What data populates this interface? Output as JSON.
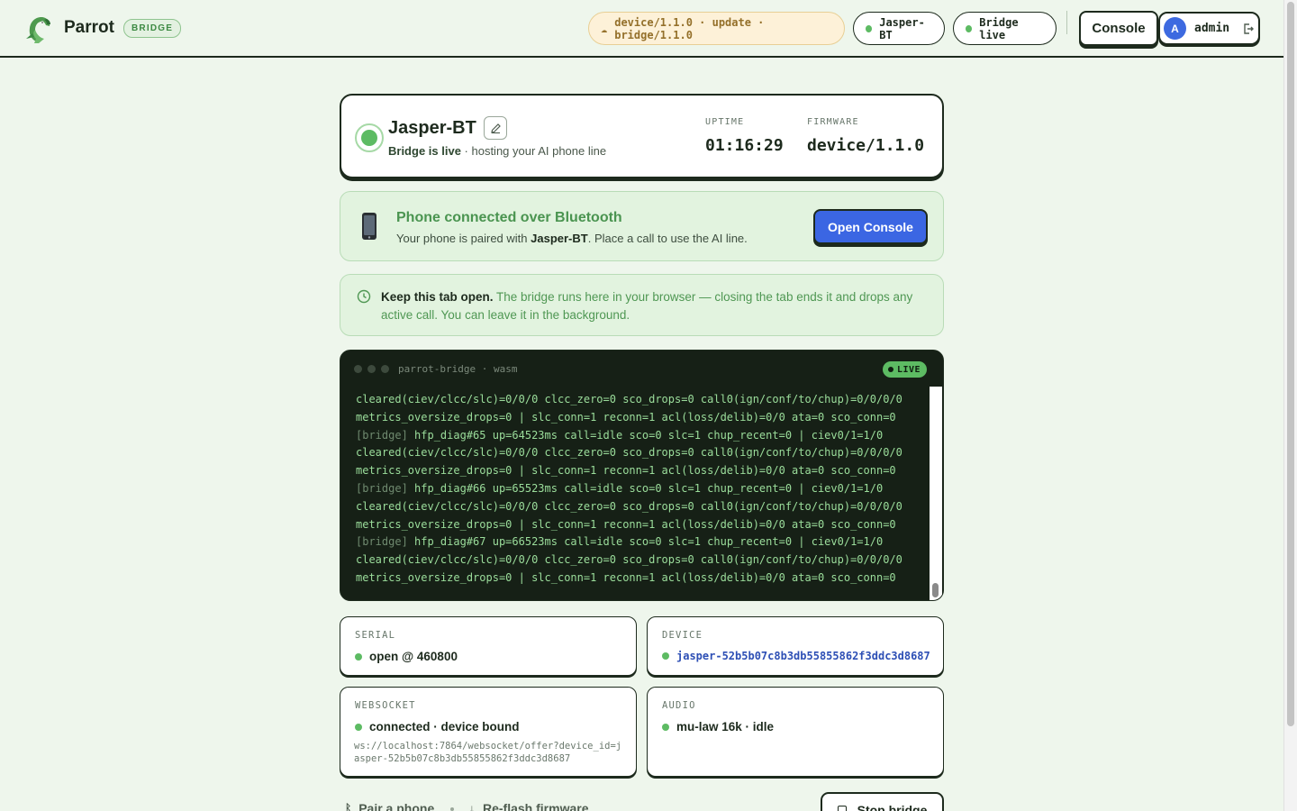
{
  "header": {
    "brand": "Parrot",
    "brand_badge": "BRIDGE",
    "update_pill": "device/1.1.0 · update · bridge/1.1.0",
    "device_pill": "Jasper-BT",
    "live_pill": "Bridge live",
    "console_button": "Console",
    "user": {
      "avatar_letter": "A",
      "name": "admin"
    }
  },
  "status": {
    "device_name": "Jasper-BT",
    "status_bold": "Bridge is live",
    "status_rest": "· hosting your AI phone line",
    "uptime_label": "UPTIME",
    "uptime_value": "01:16:29",
    "firmware_label": "FIRMWARE",
    "firmware_value": "device/1.1.0"
  },
  "bluetooth": {
    "title": "Phone connected over Bluetooth",
    "sub_prefix": "Your phone is paired with",
    "sub_device": "Jasper-BT",
    "sub_suffix": ". Place a call to use the AI line.",
    "open_console": "Open Console"
  },
  "keep_open": {
    "bold": "Keep this tab open.",
    "rest": "The bridge runs here in your browser — closing the tab ends it and drops any active call. You can leave it in the background."
  },
  "terminal": {
    "title": "parrot-bridge · wasm",
    "live_badge": "LIVE",
    "lines": [
      {
        "tag": "",
        "text": "cleared(ciev/clcc/slc)=0/0/0 clcc_zero=0 sco_drops=0 call0(ign/conf/to/chup)=0/0/0/0"
      },
      {
        "tag": "",
        "text": "metrics_oversize_drops=0 | slc_conn=1 reconn=1 acl(loss/delib)=0/0 ata=0 sco_conn=0"
      },
      {
        "tag": "[bridge]",
        "text": "hfp_diag#65 up=64523ms call=idle sco=0 slc=1 chup_recent=0 | ciev0/1=1/0"
      },
      {
        "tag": "",
        "text": "cleared(ciev/clcc/slc)=0/0/0 clcc_zero=0 sco_drops=0 call0(ign/conf/to/chup)=0/0/0/0"
      },
      {
        "tag": "",
        "text": "metrics_oversize_drops=0 | slc_conn=1 reconn=1 acl(loss/delib)=0/0 ata=0 sco_conn=0"
      },
      {
        "tag": "[bridge]",
        "text": "hfp_diag#66 up=65523ms call=idle sco=0 slc=1 chup_recent=0 | ciev0/1=1/0"
      },
      {
        "tag": "",
        "text": "cleared(ciev/clcc/slc)=0/0/0 clcc_zero=0 sco_drops=0 call0(ign/conf/to/chup)=0/0/0/0"
      },
      {
        "tag": "",
        "text": "metrics_oversize_drops=0 | slc_conn=1 reconn=1 acl(loss/delib)=0/0 ata=0 sco_conn=0"
      },
      {
        "tag": "[bridge]",
        "text": "hfp_diag#67 up=66523ms call=idle sco=0 slc=1 chup_recent=0 | ciev0/1=1/0"
      },
      {
        "tag": "",
        "text": "cleared(ciev/clcc/slc)=0/0/0 clcc_zero=0 sco_drops=0 call0(ign/conf/to/chup)=0/0/0/0"
      },
      {
        "tag": "",
        "text": "metrics_oversize_drops=0 | slc_conn=1 reconn=1 acl(loss/delib)=0/0 ata=0 sco_conn=0"
      }
    ]
  },
  "cards": {
    "serial": {
      "label": "SERIAL",
      "value": "open @ 460800"
    },
    "device": {
      "label": "DEVICE",
      "value": "jasper-52b5b07c8b3db55855862f3ddc3d8687"
    },
    "websocket": {
      "label": "WEBSOCKET",
      "value": "connected · device bound",
      "url": "ws://localhost:7864/websocket/offer?device_id=jasper-52b5b07c8b3db55855862f3ddc3d8687"
    },
    "audio": {
      "label": "AUDIO",
      "value": "mu-law 16k · idle"
    }
  },
  "footer": {
    "pair_phone": "Pair a phone",
    "reflash": "Re-flash firmware",
    "stop_bridge": "Stop bridge"
  },
  "colors": {
    "accent_green": "#5dbb63",
    "primary_blue": "#3b66e3",
    "ink": "#1d2a1d",
    "terminal_bg": "#162016"
  }
}
